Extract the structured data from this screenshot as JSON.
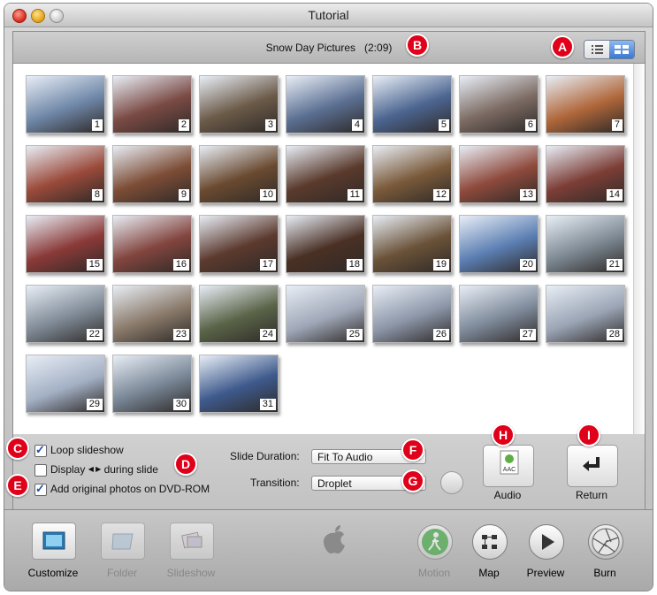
{
  "window": {
    "title": "Tutorial"
  },
  "header": {
    "picture_title": "Snow Day Pictures",
    "duration": "(2:09)"
  },
  "thumbnails": [
    {
      "n": "1",
      "c": "#6f87a8"
    },
    {
      "n": "2",
      "c": "#7a4a44"
    },
    {
      "n": "3",
      "c": "#6b5a48"
    },
    {
      "n": "4",
      "c": "#5b6f92"
    },
    {
      "n": "5",
      "c": "#4c6590"
    },
    {
      "n": "6",
      "c": "#7b6a62"
    },
    {
      "n": "7",
      "c": "#b0673a"
    },
    {
      "n": "8",
      "c": "#9a4a3a"
    },
    {
      "n": "9",
      "c": "#7d4d36"
    },
    {
      "n": "10",
      "c": "#6a4a30"
    },
    {
      "n": "11",
      "c": "#5a3a2c"
    },
    {
      "n": "12",
      "c": "#7a5a3a"
    },
    {
      "n": "13",
      "c": "#8e4a3c"
    },
    {
      "n": "14",
      "c": "#7c3e36"
    },
    {
      "n": "15",
      "c": "#8a3a38"
    },
    {
      "n": "16",
      "c": "#82453e"
    },
    {
      "n": "17",
      "c": "#5c3a2e"
    },
    {
      "n": "18",
      "c": "#4a3024"
    },
    {
      "n": "19",
      "c": "#6a5238"
    },
    {
      "n": "20",
      "c": "#5b7eb2"
    },
    {
      "n": "21",
      "c": "#7c8892"
    },
    {
      "n": "22",
      "c": "#7f8a96"
    },
    {
      "n": "23",
      "c": "#8a7a6a"
    },
    {
      "n": "24",
      "c": "#5a6448"
    },
    {
      "n": "25",
      "c": "#a0a8b8"
    },
    {
      "n": "26",
      "c": "#8c96a8"
    },
    {
      "n": "27",
      "c": "#7e8a9a"
    },
    {
      "n": "28",
      "c": "#9aa4b4"
    },
    {
      "n": "29",
      "c": "#a3b0c4"
    },
    {
      "n": "30",
      "c": "#788696"
    },
    {
      "n": "31",
      "c": "#3e5a8c"
    }
  ],
  "options": {
    "loop_label": "Loop slideshow",
    "display_label_before": "Display",
    "display_arrows": "◀ ▶",
    "display_label_after": "during slide",
    "add_originals_label": "Add original photos on DVD-ROM",
    "loop_checked": true,
    "display_checked": false,
    "add_originals_checked": true
  },
  "slide": {
    "duration_label": "Slide Duration:",
    "duration_value": "Fit To Audio",
    "transition_label": "Transition:",
    "transition_value": "Droplet"
  },
  "buttons": {
    "audio": "Audio",
    "audio_file": "AAC",
    "return": "Return"
  },
  "toolbar": {
    "customize": "Customize",
    "folder": "Folder",
    "slideshow": "Slideshow",
    "motion": "Motion",
    "map": "Map",
    "preview": "Preview",
    "burn": "Burn"
  },
  "callouts": {
    "A": "A",
    "B": "B",
    "C": "C",
    "D": "D",
    "E": "E",
    "F": "F",
    "G": "G",
    "H": "H",
    "I": "I"
  },
  "colors": {
    "badge": "#e0001a",
    "selected_view": "#3a78d4",
    "motion_green": "#3aa83a"
  }
}
